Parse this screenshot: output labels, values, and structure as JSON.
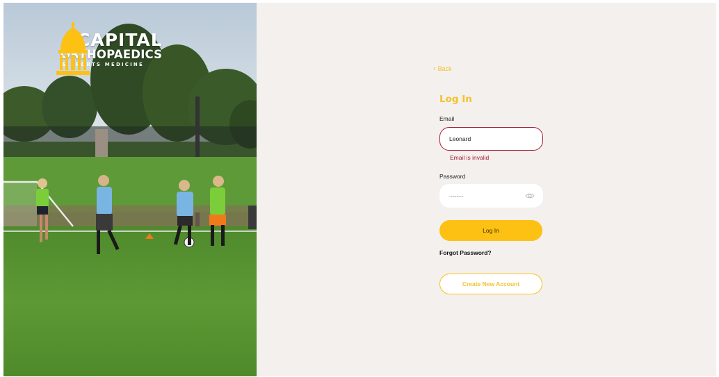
{
  "brand": {
    "line1": "CAPITAL",
    "line2": "ORTHOPAEDICS",
    "line3": "& SPORTS MEDICINE"
  },
  "nav": {
    "back_label": "Back"
  },
  "form": {
    "title": "Log In",
    "email_label": "Email",
    "email_value": "Leonard",
    "email_error": "Email is invalid",
    "password_label": "Password",
    "password_value": "..............",
    "login_button": "Log In",
    "forgot_link": "Forgot Password?",
    "create_button": "Create New Account"
  },
  "colors": {
    "accent": "#fcc113",
    "error": "#a71d33",
    "panel_bg": "#f3f0ee"
  }
}
